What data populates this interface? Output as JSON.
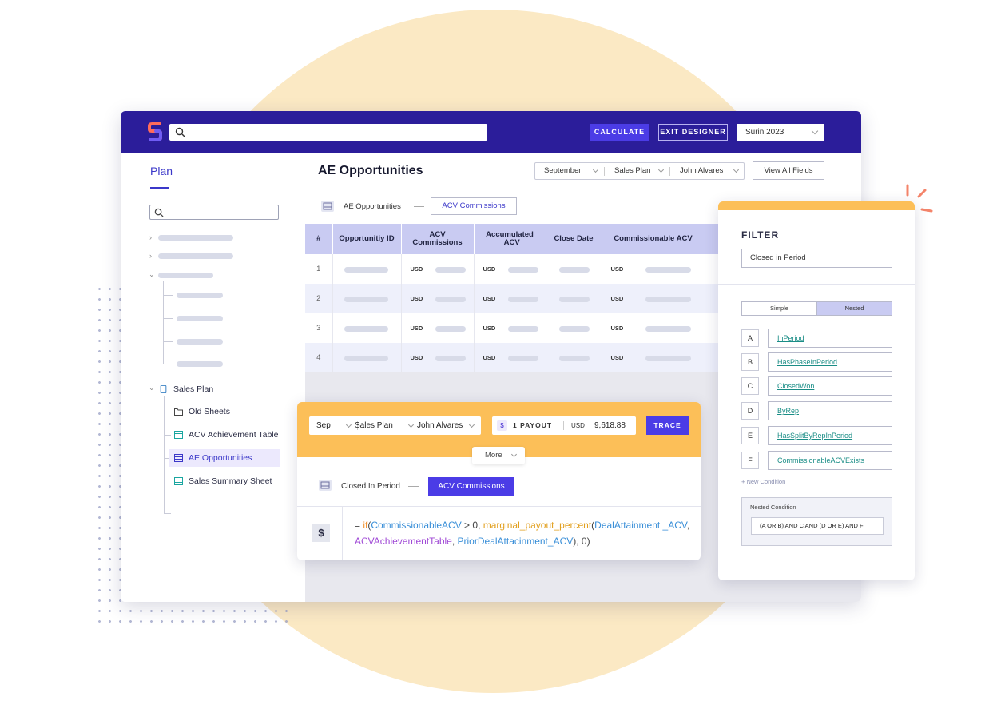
{
  "topbar": {
    "calculate_label": "CALCULATE",
    "exit_label": "EXIT DESIGNER",
    "year_select": "Surin 2023"
  },
  "sidebar": {
    "tab_label": "Plan",
    "tree": {
      "root_label": "Sales Plan",
      "items": [
        {
          "label": "Old Sheets",
          "icon": "folder-icon"
        },
        {
          "label": "ACV Achievement Table",
          "icon": "table-icon"
        },
        {
          "label": "AE Opportunities",
          "icon": "table-icon"
        },
        {
          "label": "Sales Summary Sheet",
          "icon": "table-icon"
        }
      ]
    }
  },
  "main": {
    "title": "AE Opportunities",
    "filters": {
      "month": "September",
      "plan": "Sales Plan",
      "person": "John Alvares"
    },
    "view_all_label": "View All Fields",
    "breadcrumb": {
      "label": "AE Opportunities",
      "chip": "ACV Commissions"
    },
    "table": {
      "headers": [
        "#",
        "Opportunitiy ID",
        "ACV Commissions",
        "Accumulated _ACV",
        "Close Date",
        "Commissionable ACV"
      ],
      "currency": "USD",
      "rows": [
        "1",
        "2",
        "3",
        "4"
      ]
    }
  },
  "trace": {
    "month": "Sep",
    "plan": "Sales Plan",
    "person": "John Alvares",
    "payout_icon": "$",
    "payout_label": "1 PAYOUT",
    "currency": "USD",
    "amount": "9,618.88",
    "trace_label": "TRACE",
    "more_label": "More",
    "breadcrumb_label": "Closed In Period",
    "chip": "ACV Commissions",
    "formula_icon": "$",
    "formula": {
      "eq": "= ",
      "if_kw": "if",
      "p1": "(",
      "var1": "CommissionableACV",
      "op": " > 0, ",
      "fn": "marginal_payout_percent",
      "p2": "(",
      "var2": "DealAttainment _ACV",
      "c1": ", ",
      "tbl": "ACVAchievementTable",
      "c2": ", ",
      "var3": "PriorDealAttacinment_ACV",
      "p3": "), ",
      "zero": "0",
      "p4": ")"
    }
  },
  "filter": {
    "title": "FILTER",
    "input_value": "Closed in Period",
    "modes": [
      "Simple",
      "Nested"
    ],
    "active_mode": "Nested",
    "conditions": [
      {
        "letter": "A",
        "value": "InPeriod"
      },
      {
        "letter": "B",
        "value": "HasPhaseInPeriod"
      },
      {
        "letter": "C",
        "value": "ClosedWon"
      },
      {
        "letter": "D",
        "value": "ByRep"
      },
      {
        "letter": "E",
        "value": "HasSplitByRepInPeriod"
      },
      {
        "letter": "F",
        "value": "CommissionableACVExists"
      }
    ],
    "new_condition_label": "+ New Condition",
    "nested_label": "Nested Condition",
    "nested_value": "(A OR B) AND C AND (D OR E) AND F"
  },
  "colors": {
    "brand": "#2b1d9a",
    "accent": "#4b3ce6",
    "highlight": "#fcbf58",
    "circle": "#fbe9c4"
  }
}
